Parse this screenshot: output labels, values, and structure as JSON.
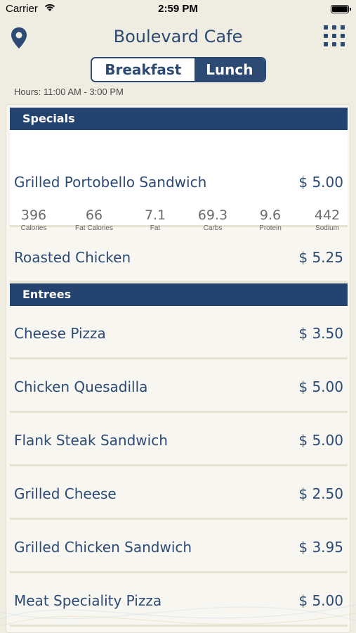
{
  "status_bar": {
    "carrier": "Carrier",
    "time": "2:59 PM"
  },
  "nav": {
    "title": "Boulevard Cafe",
    "left_icon": "map-pin-icon",
    "right_icon": "grid-icon"
  },
  "segments": {
    "breakfast": "Breakfast",
    "lunch": "Lunch",
    "selected": "Lunch"
  },
  "hours": "Hours: 11:00 AM - 3:00 PM",
  "colors": {
    "primary": "#2c4a73",
    "header": "#24436e",
    "background": "#efece2"
  },
  "sections": {
    "specials": {
      "title": "Specials",
      "items": [
        {
          "name": "Grilled Portobello Sandwich",
          "price": "$ 5.00",
          "nutrition": [
            {
              "value": "396",
              "label": "Calories"
            },
            {
              "value": "66",
              "label": "Fat Calories"
            },
            {
              "value": "7.1",
              "label": "Fat"
            },
            {
              "value": "69.3",
              "label": "Carbs"
            },
            {
              "value": "9.6",
              "label": "Protein"
            },
            {
              "value": "442",
              "label": "Sodium"
            }
          ]
        },
        {
          "name": "Roasted Chicken",
          "price": "$ 5.25"
        }
      ]
    },
    "entrees": {
      "title": "Entrees",
      "items": [
        {
          "name": "Cheese Pizza",
          "price": "$ 3.50"
        },
        {
          "name": "Chicken Quesadilla",
          "price": "$ 5.00"
        },
        {
          "name": "Flank Steak Sandwich",
          "price": "$ 5.00"
        },
        {
          "name": "Grilled Cheese",
          "price": "$ 2.50"
        },
        {
          "name": "Grilled Chicken Sandwich",
          "price": "$ 3.95"
        },
        {
          "name": "Meat Speciality Pizza",
          "price": "$ 5.00"
        }
      ]
    }
  }
}
